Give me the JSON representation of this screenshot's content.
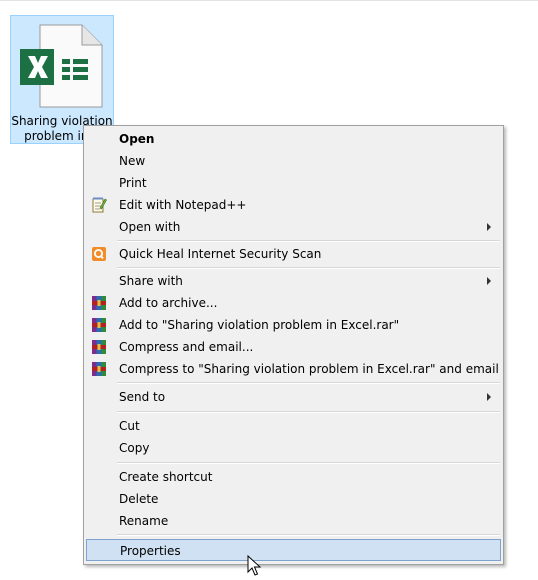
{
  "file": {
    "label_line1": "Sharing violation",
    "label_line2": "problem in E",
    "icon": "excel-file-icon",
    "icon_color": "#1d7044"
  },
  "menu": {
    "items": [
      {
        "label": "Open",
        "bold": true
      },
      {
        "label": "New"
      },
      {
        "label": "Print"
      },
      {
        "label": "Edit with Notepad++",
        "icon": "notepad-plus-plus-icon"
      },
      {
        "label": "Open with",
        "submenu": true
      },
      {
        "label": "Quick Heal Internet Security Scan",
        "icon": "quick-heal-icon"
      },
      {
        "label": "Share with",
        "submenu": true
      },
      {
        "label": "Add to archive...",
        "icon": "winrar-icon"
      },
      {
        "label": "Add to \"Sharing violation problem in Excel.rar\"",
        "icon": "winrar-icon"
      },
      {
        "label": "Compress and email...",
        "icon": "winrar-icon"
      },
      {
        "label": "Compress to \"Sharing violation problem in Excel.rar\" and email",
        "icon": "winrar-icon"
      },
      {
        "label": "Send to",
        "submenu": true
      },
      {
        "label": "Cut"
      },
      {
        "label": "Copy"
      },
      {
        "label": "Create shortcut"
      },
      {
        "label": "Delete"
      },
      {
        "label": "Rename"
      },
      {
        "label": "Properties",
        "selected": true
      }
    ]
  },
  "colors": {
    "selection_bg": "#cce8ff",
    "menu_bg": "#f0f0f0",
    "highlight": "#cfe1f3"
  }
}
